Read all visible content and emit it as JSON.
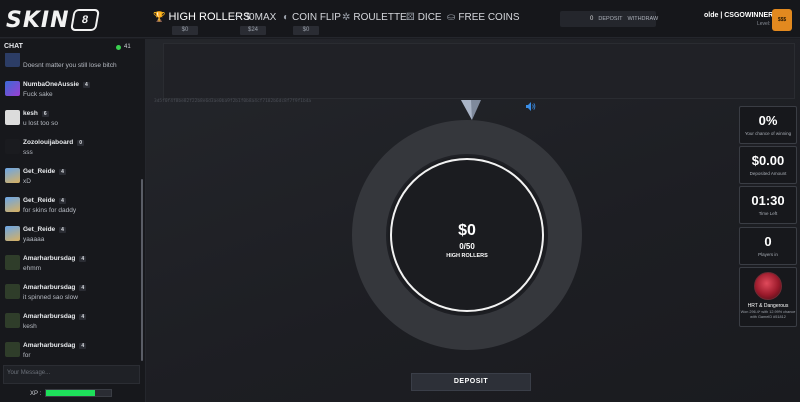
{
  "header": {
    "logo_text": "SKIN",
    "logo_badge": "8",
    "nav": [
      {
        "label": "HIGH ROLLERS",
        "sub": "$0"
      },
      {
        "label": "30MAX",
        "sub": "$24"
      },
      {
        "label": "COIN FLIP",
        "sub": "$0"
      },
      {
        "label": "ROULETTE"
      },
      {
        "label": "DICE"
      },
      {
        "label": "FREE COINS"
      }
    ],
    "balance": "0",
    "deposit_label": "DEPOSIT",
    "withdraw_label": "WITHDRAW",
    "username": "olde | CSGOWINNER.c...",
    "level": "Level: 1",
    "avatar_text": "$$$"
  },
  "chat": {
    "title": "CHAT",
    "online": "41",
    "messages": [
      {
        "name": "",
        "level": "",
        "text": "Doesnt matter you still lose bitch"
      },
      {
        "name": "NumbaOneAussie",
        "level": "4",
        "text": "Fuck sake"
      },
      {
        "name": "kesh",
        "level": "6",
        "text": "u lost too so"
      },
      {
        "name": "Zozolouijaboard",
        "level": "0",
        "text": "sss"
      },
      {
        "name": "Get_Reide",
        "level": "4",
        "text": "xD"
      },
      {
        "name": "Get_Reide",
        "level": "4",
        "text": "for skins for daddy"
      },
      {
        "name": "Get_Reide",
        "level": "4",
        "text": "yaaaaa"
      },
      {
        "name": "Amarharbursdag",
        "level": "4",
        "text": "ehmm"
      },
      {
        "name": "Amarharbursdag",
        "level": "4",
        "text": "it spinned sao slow"
      },
      {
        "name": "Amarharbursdag",
        "level": "4",
        "text": "kesh"
      },
      {
        "name": "Amarharbursdag",
        "level": "4",
        "text": "for"
      }
    ],
    "input_placeholder": "Your Message...",
    "xp_label": "XP :",
    "xp_progress": 0.75
  },
  "game": {
    "hash": "3d5f0f4f8be82f22b8e6d3ae0ba9f2b1f0b8a4cf7182b6dc8f7f9f1b4a",
    "amount": "$0",
    "count": "0/50",
    "mode": "HIGH ROLLERS",
    "deposit_label": "DEPOSIT"
  },
  "stats": [
    {
      "value": "0%",
      "label": "Your chance of winning"
    },
    {
      "value": "$0.00",
      "label": "Deposited Amount"
    },
    {
      "value": "01:30",
      "label": "Time Left"
    },
    {
      "value": "0",
      "label": "Players in"
    }
  ],
  "winner": {
    "name": "HRT & Dangerous",
    "info": "Won 296.4* with 12.99% chance with GameID #51812"
  },
  "colors": {
    "accent": "#e8b531",
    "xp": "#1ee05a",
    "online": "#3ad04f"
  }
}
